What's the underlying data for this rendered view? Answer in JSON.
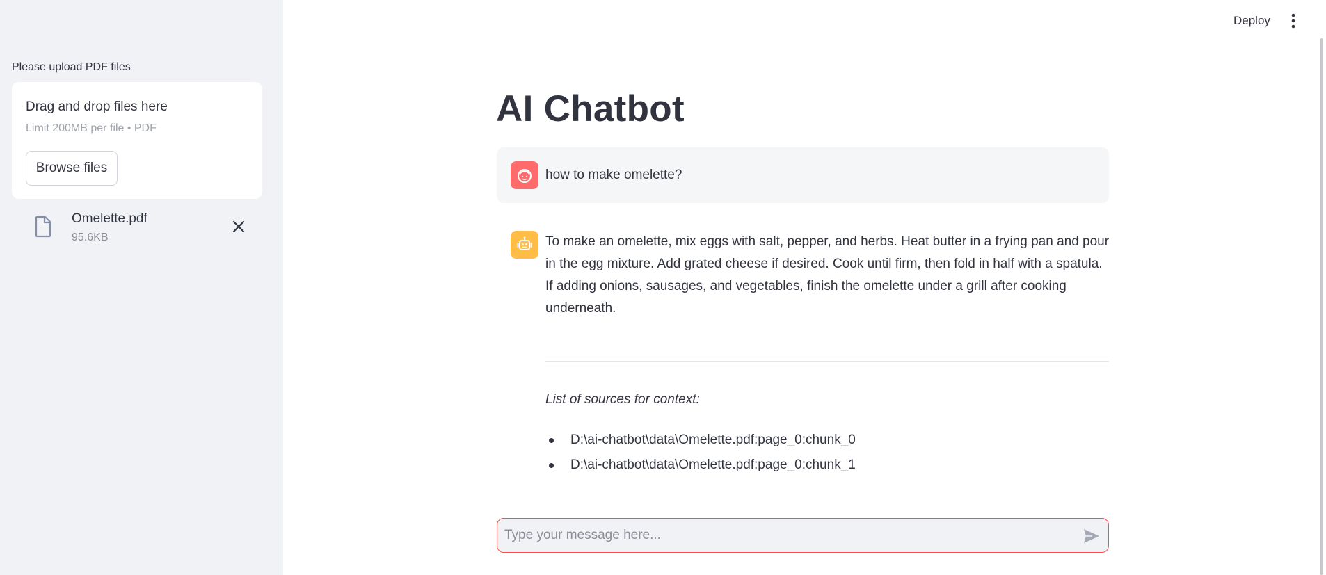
{
  "sidebar": {
    "upload_label": "Please upload PDF files",
    "dropzone": {
      "title": "Drag and drop files here",
      "limit": "Limit 200MB per file • PDF",
      "browse_label": "Browse files"
    },
    "files": [
      {
        "name": "Omelette.pdf",
        "size": "95.6KB",
        "icon": "file-icon"
      }
    ]
  },
  "header": {
    "deploy_label": "Deploy",
    "menu_icon": "more-vertical-icon"
  },
  "main": {
    "title": "AI Chatbot",
    "messages": [
      {
        "role": "user",
        "avatar_icon": "user-face-icon",
        "text": "how to make omelette?"
      },
      {
        "role": "assistant",
        "avatar_icon": "robot-icon",
        "text": "To make an omelette, mix eggs with salt, pepper, and herbs. Heat butter in a frying pan and pour in the egg mixture. Add grated cheese if desired. Cook until firm, then fold in half with a spatula. If adding onions, sausages, and vegetables, finish the omelette under a grill after cooking underneath.",
        "sources_heading": "List of sources for context:",
        "sources": [
          "D:\\ai-chatbot\\data\\Omelette.pdf:page_0:chunk_0",
          "D:\\ai-chatbot\\data\\Omelette.pdf:page_0:chunk_1"
        ]
      }
    ]
  },
  "chat_input": {
    "placeholder": "Type your message here...",
    "value": "",
    "send_icon": "send-icon"
  },
  "colors": {
    "sidebar_bg": "#f0f2f6",
    "user_avatar": "#ff6b6b",
    "bot_avatar": "#ffbd45",
    "input_border": "#ff4b4b",
    "text": "#31333f"
  }
}
